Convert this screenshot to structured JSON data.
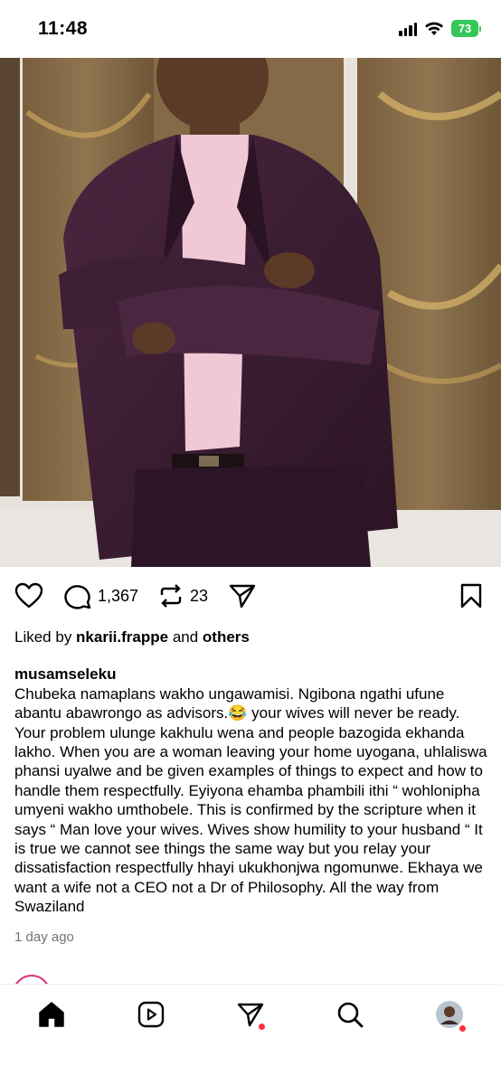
{
  "status_bar": {
    "time": "11:48",
    "battery": "73",
    "icons": [
      "signal-icon",
      "wifi-icon",
      "battery-icon"
    ]
  },
  "post": {
    "image_alt_icon": "photo",
    "actions": {
      "comments_count": "1,367",
      "reposts_count": "23"
    },
    "liked_prefix": "Liked by ",
    "liked_user": "nkarii.frappe",
    "liked_and": " and ",
    "liked_others": "others",
    "caption_user": "musamseleku",
    "caption_text": "Chubeka namaplans wakho ungawamisi. Ngibona ngathi ufune abantu abawrongo as advisors.😂 your wives will never be ready. Your problem ulunge kakhulu wena and people bazogida ekhanda lakho. When you are a woman leaving your home uyogana, uhlaliswa phansi uyalwe and be given examples of things to expect and how to handle them respectfully.  Eyiyona ehamba phambili ithi “ wohlonipha umyeni wakho umthobele. This is confirmed by the scripture when it says “ Man love your  wives. Wives show humility to your husband “  It is true we cannot see things the same way but you relay your dissatisfaction respectfully hhayi ukukhonjwa ngomunwe. Ekhaya we want a wife not a CEO not a Dr of Philosophy. All the way from Swaziland",
    "time_ago": "1 day ago"
  },
  "nav": {
    "items": [
      "home-icon",
      "reels-icon",
      "direct-icon",
      "search-icon",
      "profile-avatar"
    ]
  },
  "colors": {
    "battery": "#34c759",
    "notification_dot": "#ff3040",
    "suit": "#3b1f33",
    "shirt": "#f1c8d6"
  }
}
